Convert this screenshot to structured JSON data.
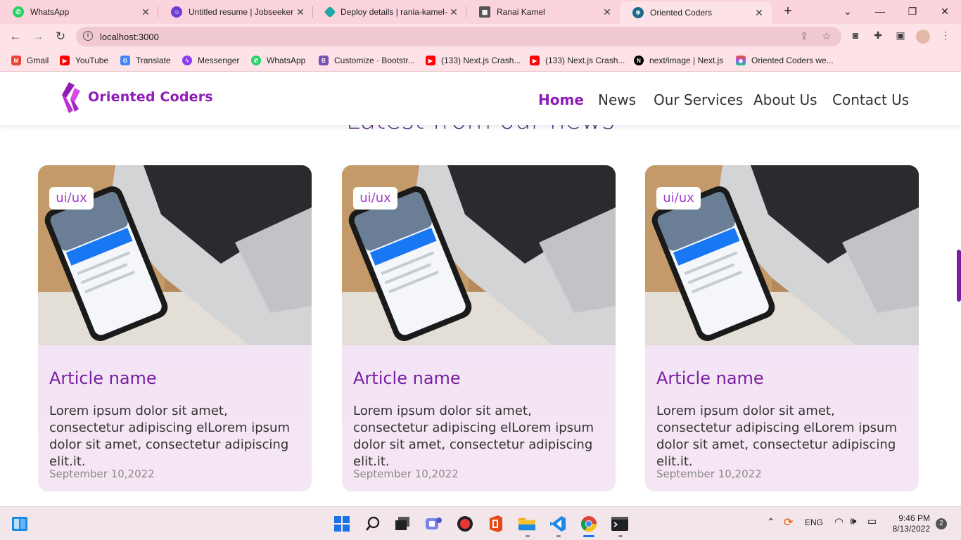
{
  "tabs": [
    {
      "title": "WhatsApp",
      "icon": "whatsapp-icon",
      "color": "#25d366"
    },
    {
      "title": "Untitled resume | Jobseeker",
      "icon": "jobseeker-icon",
      "color": "#6c3cd6"
    },
    {
      "title": "Deploy details | rania-kamel-",
      "icon": "netlify-icon",
      "color": "#20a6a6"
    },
    {
      "title": "Ranai Kamel",
      "icon": "portfolio-icon",
      "color": "#555555"
    },
    {
      "title": "Oriented Coders",
      "icon": "react-icon",
      "color": "#1b6b8f"
    }
  ],
  "browser": {
    "url": "localhost:3000"
  },
  "bookmarks": [
    {
      "label": "Gmail",
      "icon": "gmail-icon",
      "color": "#ea4335"
    },
    {
      "label": "YouTube",
      "icon": "youtube-icon",
      "color": "#ff0000"
    },
    {
      "label": "Translate",
      "icon": "translate-icon",
      "color": "#4285f4"
    },
    {
      "label": "Messenger",
      "icon": "messenger-icon",
      "color": "#8b3cf5"
    },
    {
      "label": "WhatsApp",
      "icon": "whatsapp-icon",
      "color": "#25d366"
    },
    {
      "label": "Customize · Bootstr...",
      "icon": "bootstrap-icon",
      "color": "#7952b3"
    },
    {
      "label": "(133) Next.js Crash...",
      "icon": "youtube-icon",
      "color": "#ff0000"
    },
    {
      "label": "(133) Next.js Crash...",
      "icon": "youtube-icon",
      "color": "#ff0000"
    },
    {
      "label": "next/image | Next.js",
      "icon": "nextjs-icon",
      "color": "#000000"
    },
    {
      "label": "Oriented Coders we...",
      "icon": "figma-icon",
      "color": "#f24e1e"
    }
  ],
  "site": {
    "logo": "Oriented Coders",
    "nav": [
      "Home",
      "News",
      "Our Services",
      "About Us",
      "Contact Us"
    ],
    "section_heading": "Latest from our news"
  },
  "articles": [
    {
      "badge": "ui/ux",
      "title": "Article name",
      "desc": "Lorem ipsum dolor sit amet, consectetur adipiscing elLorem ipsum dolor sit amet, consectetur adipiscing elit.it.",
      "date": "September 10,2022"
    },
    {
      "badge": "ui/ux",
      "title": "Article name",
      "desc": "Lorem ipsum dolor sit amet, consectetur adipiscing elLorem ipsum dolor sit amet, consectetur adipiscing elit.it.",
      "date": "September 10,2022"
    },
    {
      "badge": "ui/ux",
      "title": "Article name",
      "desc": "Lorem ipsum dolor sit amet, consectetur adipiscing elLorem ipsum dolor sit amet, consectetur adipiscing elit.it.",
      "date": "September 10,2022"
    }
  ],
  "taskbar": {
    "apps": [
      "windows-start-icon",
      "search-icon",
      "task-view-icon",
      "teams-icon",
      "recorder-icon",
      "office-icon",
      "file-explorer-icon",
      "vscode-icon",
      "chrome-icon",
      "terminal-icon"
    ],
    "language": "ENG",
    "time": "9:46 PM",
    "date": "8/13/2022",
    "notifications": "2"
  },
  "colors": {
    "brand": "#8e1cb5",
    "tab_bar": "#fbd3dc",
    "toolbar": "#fde3e7"
  }
}
